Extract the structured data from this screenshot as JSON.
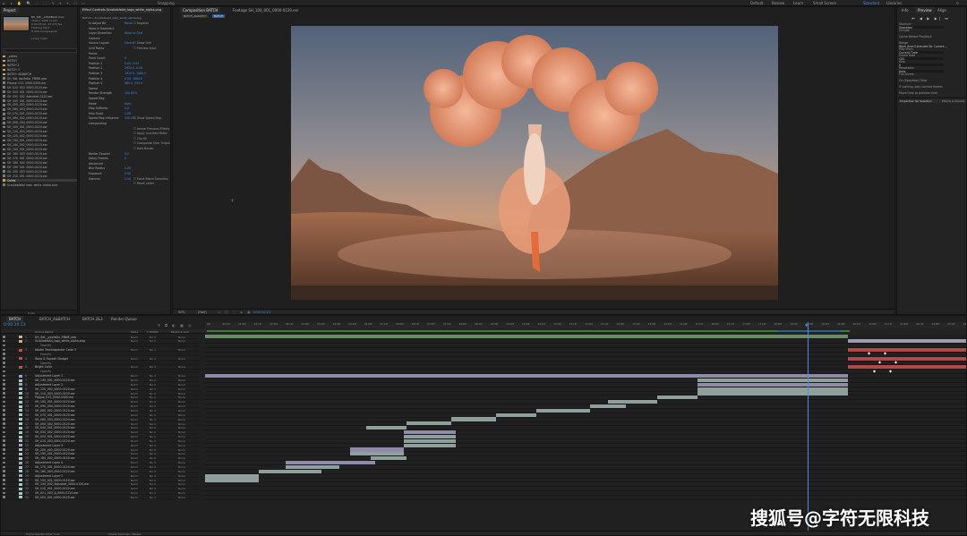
{
  "menubar": {
    "app_hint": "Snapping",
    "workspaces": [
      "Default",
      "Review",
      "Learn",
      "Small Screen",
      "Standard",
      "Libraries"
    ],
    "active_workspace": "Standard"
  },
  "project_panel": {
    "tab": "Project",
    "preview_name": "Dh_Sdt__ArtistBank.mov",
    "preview_info": [
      "1920 x 1080 (1.00)",
      "0:00:05:01, 23.976 fps",
      "Floating Point",
      "H.264 Compression"
    ],
    "search_label": "Linear Light",
    "items": [
      "_plates",
      "BATCH",
      "BATCH 2",
      "BATCH_3",
      "BATCH_4&BATCH",
      "Dh_Sdt_ppvfaDu_FBWK.aep",
      "Plague_013_0000-0500.exr",
      "SH_010_003_0000-0120.exr",
      "SH_020_001_0000-0120.exr",
      "SH_030_002_Adjusted-0120.exr",
      "SH_040_001_0000-0120.exr",
      "SH_050_002_0000-0120.exr",
      "SH_060_003_0000-0120.exr",
      "SH_070_001_0000-0120.exr",
      "SH_080_002_0000-0120.exr",
      "SH_090_004_0000-0120.exr",
      "SH_100_001_0000-0120.exr",
      "SH_110_003_0000-0120.exr",
      "SH_120_002_0000-0120.exr",
      "SH_130_001_0000-0120.exr",
      "SH_140_002_0000-0120.exr",
      "SH_150_001_0000-0120.exr",
      "SH_160_003_0000-0120.exr",
      "SH_170_001_0000-0120.exr",
      "SH_180_002_0000-0120.exr",
      "SH_190_001_0000-0120.exr",
      "SH_200_003_0000-0120.exr",
      "SH_210_001_0000-0120.exr",
      "Solids",
      "ScrollableAd_logo_white_alpha.png"
    ],
    "bottom_label": "8 bpc"
  },
  "effects_panel": {
    "tabs": [
      "Effect Controls ScrollableAd_logo_white_alpha.png"
    ],
    "header": "BATCH • ScrollableAd_logo_white_alpha.png",
    "lines": [
      {
        "label": "fx Adjust Bit",
        "value": "Reset",
        "extra": "Register"
      },
      {
        "label": "Warp & Geometry",
        "value": ""
      },
      {
        "label": "Layer Distortion",
        "value": "Warp to Grid",
        "extra": ""
      },
      {
        "label": "Camera",
        "value": ""
      },
      {
        "label": "Source Layout",
        "value": "Centre",
        "extra": "Show Grid"
      },
      {
        "label": "Grid Points",
        "value": "",
        "extra": "Preview Input"
      },
      {
        "label": "Points",
        "value": ""
      },
      {
        "label": "Point Count",
        "value": "4"
      },
      {
        "label": "Position 1",
        "value": "0.00, 0.00"
      },
      {
        "label": "Position 2",
        "value": "1920.0, 0.00"
      },
      {
        "label": "Position 3",
        "value": "1920.0, 1080.0"
      },
      {
        "label": "Position 4",
        "value": "0.00, 1080.0"
      },
      {
        "label": "Position 5",
        "value": "960.0, 540.0"
      },
      {
        "label": "Speed",
        "value": ""
      },
      {
        "label": "Render Strength",
        "value": "100.00%"
      },
      {
        "label": "Speed Map",
        "value": ""
      },
      {
        "label": "Mode",
        "value": "Auto"
      },
      {
        "label": "Map Softness",
        "value": "0.0"
      },
      {
        "label": "Map Scale",
        "value": "1.00"
      },
      {
        "label": "Speed Map Influence",
        "value": "100.0%",
        "extra": "Show Speed Map"
      },
      {
        "label": "Compositing",
        "value": ""
      },
      {
        "label": "",
        "value": "",
        "extra": "Ignore Previous Effects"
      },
      {
        "label": "",
        "value": "",
        "extra": "Apply Inverted Matte"
      },
      {
        "label": "",
        "value": "",
        "extra": "Clip Fill"
      },
      {
        "label": "",
        "value": "",
        "extra": "Composite Over Original"
      },
      {
        "label": "",
        "value": "",
        "extra": "Hold Border"
      },
      {
        "label": "Border Expand",
        "value": "0.0"
      },
      {
        "label": "Delay Frames",
        "value": "0"
      },
      {
        "label": "Advanced",
        "value": ""
      },
      {
        "label": "Blur Radius",
        "value": "0.00"
      },
      {
        "label": "Exposure",
        "value": "0.00"
      },
      {
        "label": "Gamma",
        "value": "1.00",
        "extra": "Force Blend Sampling"
      },
      {
        "label": "",
        "value": "",
        "extra": "Reset Letter"
      }
    ]
  },
  "composition_panel": {
    "tabs": [
      "Composition BATCH",
      "Footage SH_100_001_0000-0120.exr"
    ],
    "breadcrumb": [
      "BATCH_4&BATCH",
      "BATCH"
    ],
    "zoom": "50%",
    "resolution": "(Half)",
    "time": "0:00:10:13"
  },
  "right_panel": {
    "tabs": [
      "Info",
      "Preview",
      "Align"
    ],
    "sections": [
      {
        "label": "Shortcut",
        "value": "Spacebar"
      },
      {
        "label": "Include",
        "value": ""
      },
      {
        "label": "Cache Before Playback",
        "value": ""
      },
      {
        "label": "Range",
        "value": "Work Area Extended By Current..."
      },
      {
        "label": "Play From",
        "value": "Current Time"
      },
      {
        "label": "Frame Rate",
        "value": "(24)"
      },
      {
        "label": "Skip",
        "value": "0"
      },
      {
        "label": "Resolution",
        "value": "Auto"
      },
      {
        "label": "Full Screen",
        "value": ""
      },
      {
        "label": "On (Spacebar) Stop",
        "value": ""
      },
      {
        "label": "If caching, play cached frames",
        "value": ""
      },
      {
        "label": "Move time to preview time",
        "value": ""
      }
    ],
    "bottom_tabs": [
      "Properties: No Selection",
      "Effects & Presets"
    ]
  },
  "timeline": {
    "tabs": [
      "BATCH",
      "BATCH_4&BATCH",
      "BATCH 2&3",
      "Render Queue"
    ],
    "timecode": "0:00:10:13",
    "columns": [
      "Source Name",
      "Mode",
      "T TrkMat",
      "Parent & Link"
    ],
    "ruler_ticks": [
      "00f",
      "00:12f",
      "01:00f",
      "01:12f",
      "02:00f",
      "02:12f",
      "03:00f",
      "03:12f",
      "04:00f",
      "04:12f",
      "05:00f",
      "05:12f",
      "06:00f",
      "06:12f",
      "07:00f",
      "07:12f",
      "08:00f",
      "08:12f",
      "09:00f",
      "09:12f",
      "10:00f",
      "10:12f",
      "11:00f",
      "11:12f",
      "12:00f",
      "12:12f",
      "13:00f",
      "13:12f",
      "14:00f",
      "14:12f",
      "15:00f",
      "15:12f",
      "16:00f",
      "16:12f",
      "17:00f",
      "17:12f",
      "18:00f",
      "18:12f",
      "19:00f",
      "19:12f",
      "20:00f",
      "20:12f",
      "21:00f",
      "21:12f",
      "22:00f",
      "22:12f",
      "23:00f",
      "23:12f",
      "24:00f"
    ],
    "layers": [
      {
        "num": "1",
        "name": "Dh_Sdt__ppvfaDu_FBWK_aep",
        "label_color": "#c2b28a"
      },
      {
        "num": "2",
        "name": "ScrollableAd_logo_white_alpha.png",
        "label_color": "#c2b28a"
      },
      {
        "num": "",
        "name": "Opacity",
        "label_color": ""
      },
      {
        "num": "3",
        "name": "Adobe Tractinspector Color 3",
        "label_color": "#c0504d"
      },
      {
        "num": "",
        "name": "Opacity",
        "label_color": ""
      },
      {
        "num": "4",
        "name": "Warp & Squash Dodger",
        "label_color": "#c0504d"
      },
      {
        "num": "",
        "name": "Opacity",
        "label_color": ""
      },
      {
        "num": "5",
        "name": "Bright Color",
        "label_color": "#c0504d"
      },
      {
        "num": "",
        "name": "Opacity",
        "label_color": ""
      },
      {
        "num": "6",
        "name": "Adjustment Layer 1",
        "label_color": "#a29ec8"
      },
      {
        "num": "7",
        "name": "SH_130_001_0000-0120.exr",
        "label_color": "#a8c7c0"
      },
      {
        "num": "8",
        "name": "Adjustment Layer 2",
        "label_color": "#a29ec8"
      },
      {
        "num": "9",
        "name": "SH_120_002_0000-0120.exr",
        "label_color": "#a8c7c0"
      },
      {
        "num": "10",
        "name": "SH_110_003_0000-0120.exr",
        "label_color": "#a8c7c0"
      },
      {
        "num": "11",
        "name": "Plague_013_0000-0500.exr",
        "label_color": "#a8c7c0"
      },
      {
        "num": "12",
        "name": "SH_100_001_0000-0120.exr",
        "label_color": "#a8c7c0"
      },
      {
        "num": "13",
        "name": "SH_090_004_0000-0120.exr",
        "label_color": "#a8c7c0"
      },
      {
        "num": "14",
        "name": "SH_080_002_0000-0120.exr",
        "label_color": "#a8c7c0"
      },
      {
        "num": "15",
        "name": "SH_070_001_0000-0120.exr",
        "label_color": "#a8c7c0"
      },
      {
        "num": "16",
        "name": "SH_060_003_0000-0120.exr",
        "label_color": "#a8c7c0"
      },
      {
        "num": "17",
        "name": "SH_050_002_0000-0120.exr",
        "label_color": "#a8c7c0"
      },
      {
        "num": "18",
        "name": "SH_040_001_0000-0120.exr",
        "label_color": "#a8c7c0"
      },
      {
        "num": "19",
        "name": "SH_030_002_0000-0120.exr",
        "label_color": "#a8c7c0"
      },
      {
        "num": "20",
        "name": "SH_020_001_0000-0120.exr",
        "label_color": "#a8c7c0"
      },
      {
        "num": "21",
        "name": "SH_010_003_0000-0120.exr",
        "label_color": "#a8c7c0"
      },
      {
        "num": "22",
        "name": "Adjustment Layer 3",
        "label_color": "#a29ec8"
      },
      {
        "num": "23",
        "name": "SH_200_003_0000-0120.exr",
        "label_color": "#a8c7c0"
      },
      {
        "num": "24",
        "name": "SH_190_001_0000-0120.exr",
        "label_color": "#a8c7c0"
      },
      {
        "num": "25",
        "name": "SH_180_002_0000-0120.exr",
        "label_color": "#a8c7c0"
      },
      {
        "num": "26",
        "name": "Adjustment Layer 4",
        "label_color": "#a29ec8"
      },
      {
        "num": "27",
        "name": "SH_170_001_0000-0120.exr",
        "label_color": "#a8c7c0"
      },
      {
        "num": "28",
        "name": "SH_160_003_0000-0120.exr",
        "label_color": "#a8c7c0"
      },
      {
        "num": "29",
        "name": "Adjustment Layer 5",
        "label_color": "#a29ec8"
      },
      {
        "num": "30",
        "name": "SH_150_001_0000-0120.exr",
        "label_color": "#a8c7c0"
      },
      {
        "num": "31",
        "name": "SH_140_002_Adjusted_0000-0120.exr",
        "label_color": "#a8c7c0"
      },
      {
        "num": "32",
        "name": "SH_210_001_0000-0120.exr",
        "label_color": "#a8c7c0"
      },
      {
        "num": "33",
        "name": "SH_021_003_A_0000-0120.exr",
        "label_color": "#a8c7c0"
      },
      {
        "num": "34",
        "name": "SH_005_001_0000-0120.exr",
        "label_color": "#a8c7c0"
      }
    ],
    "layer_mode": "Norm",
    "layer_trkmat": "No 4",
    "layer_parent": "None",
    "status": "Frame Render Time: 5.2s",
    "status_right": "Toggle Switches / Modes"
  },
  "watermark": "搜狐号@字符无限科技"
}
